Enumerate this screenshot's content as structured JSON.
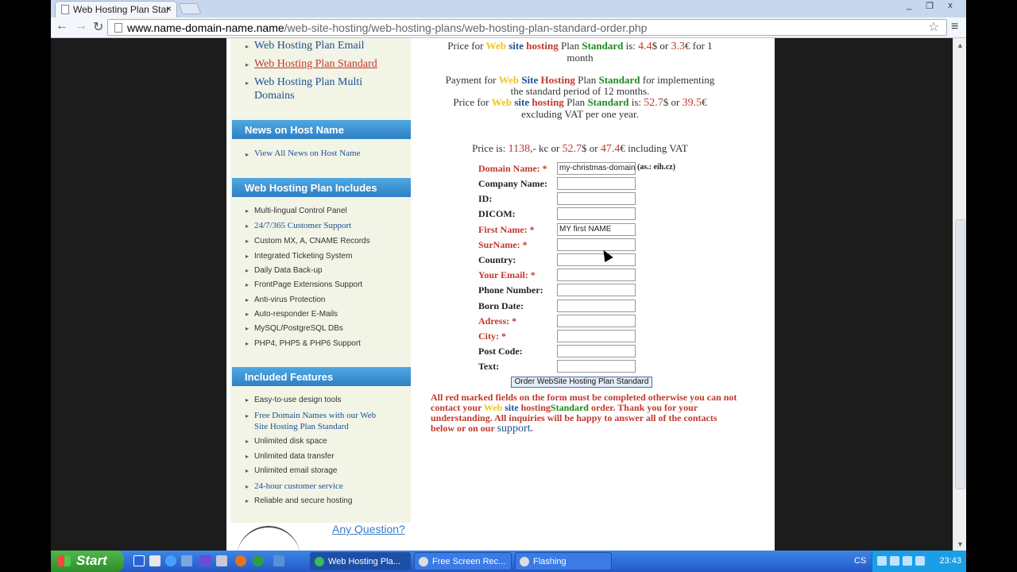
{
  "browser": {
    "tab_title": "Web Hosting Plan Star",
    "tab_close": "×",
    "url_host": "www.name-domain-name.name",
    "url_path": "/web-site-hosting/web-hosting-plans/web-hosting-plan-standard-order.php",
    "win_min": "_",
    "win_max": "❐",
    "win_close": "x",
    "back": "←",
    "forward": "→",
    "reload": "↻",
    "star": "☆",
    "menu": "≡"
  },
  "sidebar": {
    "links": [
      "Web Hosting Plan Email",
      "Web Hosting Plan Standard",
      "Web Hosting Plan Multi",
      "Domains"
    ],
    "news_heading": "News on Host Name",
    "news_link": "View All News on Host Name",
    "includes_heading": "Web Hosting Plan Includes",
    "includes": [
      "Multi-lingual Control Panel",
      "24/7/365 Customer Support",
      "Custom MX, A, CNAME Records",
      "Integrated Ticketing System",
      "Daily Data Back-up",
      "FrontPage Extensions Support",
      "Anti-virus Protection",
      "Auto-responder E-Mails",
      "MySQL/PostgreSQL DBs",
      "PHP4, PHP5 & PHP6 Support"
    ],
    "features_heading": "Included Features",
    "features": [
      "Easy-to-use design tools",
      "Free Domain Names with our Web",
      "Site Hosting Plan Standard",
      "Unlimited disk space",
      "Unlimited data transfer",
      "Unlimited email storage",
      "24-hour customer service",
      "Reliable and secure hosting"
    ],
    "any_question": "Any Question?"
  },
  "main": {
    "price_line1": {
      "pre": "Price for ",
      "web": "Web",
      "site": " site",
      "hosting": " hosting",
      "plan": " Plan ",
      "standard": "Standard",
      "is": " is: ",
      "usd": "4.4",
      "usd_sym": "$ or ",
      "eur": "3.3",
      "eur_sym": "€ for 1",
      "tail": "month"
    },
    "payment": {
      "pre": "Payment for ",
      "web": "Web",
      "site": " Site",
      "hosting": " Hosting",
      "plan": " Plan ",
      "standard": "Standard",
      "post": " for implementing",
      "line2": "the standard period of 12 months."
    },
    "price_line2": {
      "pre": "Price for ",
      "web": "Web",
      "site": " site",
      "hosting": " hosting",
      "plan": " Plan ",
      "standard": "Standard",
      "is": " is: ",
      "usd": "52.7",
      "usd_sym": "$ or ",
      "eur": "39.5",
      "eur_sym": "€",
      "tail": "excluding VAT per one year."
    },
    "total": {
      "pre": "Price is: ",
      "kc": "1138",
      "kc_sym": ",- kc or ",
      "usd": "52.7",
      "usd_sym": "$ or ",
      "eur": "47.4",
      "eur_sym": "€ including VAT"
    },
    "form": [
      {
        "label": "Domain Name: *",
        "value": "my-christmas-domain",
        "required": true
      },
      {
        "label": "Company Name:",
        "value": "",
        "required": false
      },
      {
        "label": "ID:",
        "value": "",
        "required": false
      },
      {
        "label": "DICOM:",
        "value": "",
        "required": false
      },
      {
        "label": "First Name: *",
        "value": "MY first NAME",
        "required": true
      },
      {
        "label": "SurName: *",
        "value": "",
        "required": true
      },
      {
        "label": "Country:",
        "value": "",
        "required": false
      },
      {
        "label": "Your Email: *",
        "value": "",
        "required": true
      },
      {
        "label": "Phone Number:",
        "value": "",
        "required": false
      },
      {
        "label": "Born Date:",
        "value": "",
        "required": false
      },
      {
        "label": "Adress: *",
        "value": "",
        "required": true
      },
      {
        "label": "City: *",
        "value": "",
        "required": true
      },
      {
        "label": "Post Code:",
        "value": "",
        "required": false
      },
      {
        "label": "Text:",
        "value": "",
        "required": false
      }
    ],
    "domain_hint": "(as.: eih.cz)",
    "submit_label": "Order WebSite Hosting Plan Standard",
    "notice": {
      "p1": "All red marked fields on the form must be completed otherwise you can not contact your ",
      "web": "Web",
      "site": " site",
      "hosting": " hosting",
      "standard": "Standard",
      "p2": " order. Thank you for your understanding. All inquiries will be happy to answer all of the contacts below or on our ",
      "support": "support",
      "p3": "."
    }
  },
  "taskbar": {
    "start": "Start",
    "tasks": [
      "Web Hosting Pla...",
      "Free Screen Rec...",
      "Flashing"
    ],
    "lang": "CS",
    "clock": "23:43"
  }
}
